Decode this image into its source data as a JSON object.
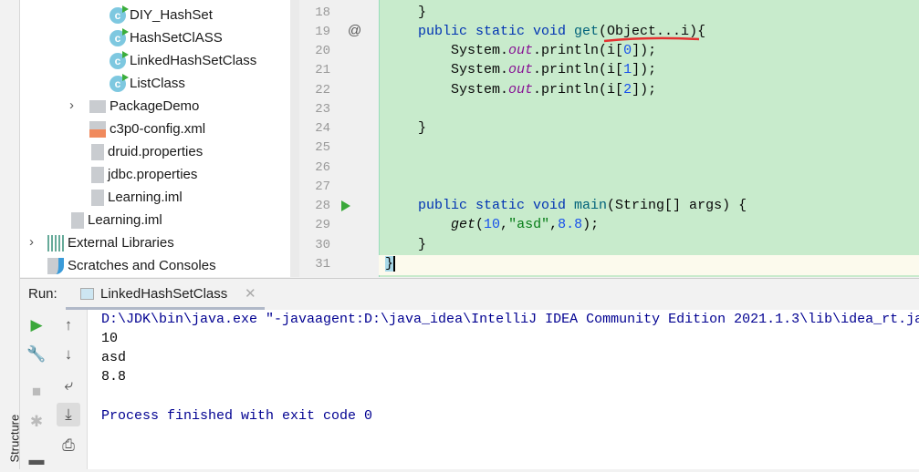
{
  "sidebar": {
    "structure_label": "Structure"
  },
  "project_tree": [
    {
      "label": "DIY_HashSet",
      "icon": "java-class-runnable-icon"
    },
    {
      "label": "HashSetClASS",
      "icon": "java-class-runnable-icon"
    },
    {
      "label": "LinkedHashSetClass",
      "icon": "java-class-runnable-icon"
    },
    {
      "label": "ListClass",
      "icon": "java-class-runnable-icon"
    },
    {
      "label": "PackageDemo",
      "icon": "package-folder-icon"
    },
    {
      "label": "c3p0-config.xml",
      "icon": "xml-file-icon"
    },
    {
      "label": "druid.properties",
      "icon": "properties-file-icon"
    },
    {
      "label": "jdbc.properties",
      "icon": "properties-file-icon"
    },
    {
      "label": "Learning.iml",
      "icon": "iml-file-icon"
    },
    {
      "label": "Learning.iml",
      "icon": "iml-file-icon"
    },
    {
      "label": "External Libraries",
      "icon": "libraries-icon"
    },
    {
      "label": "Scratches and Consoles",
      "icon": "scratches-icon"
    }
  ],
  "editor": {
    "line_numbers": [
      "18",
      "19",
      "20",
      "21",
      "22",
      "23",
      "24",
      "25",
      "26",
      "27",
      "28",
      "29",
      "30",
      "31"
    ],
    "lines": {
      "l18": "}",
      "l19_kw": "public static void ",
      "l19_fn": "get",
      "l19_rest": "(Object...i){",
      "l20a": "System.",
      "out": "out",
      "l20b": ".println(i[",
      "n0": "0",
      "n1": "1",
      "n2": "2",
      "close": "]);",
      "l24": "}",
      "l28_kw": "public static void ",
      "l28_fn": "main",
      "l28_rest": "(String[] args) {",
      "l29_fn": "get",
      "l29_p": "(",
      "l29_n1": "10",
      "l29_c": ",",
      "l29_s": "\"asd\"",
      "l29_n2": "8.8",
      "l29_end": ");",
      "l30": "}",
      "l31": "}"
    },
    "override_marker": "@"
  },
  "run_panel": {
    "label": "Run:",
    "tab": "LinkedHashSetClass",
    "console": [
      "D:\\JDK\\bin\\java.exe \"-javaagent:D:\\java_idea\\IntelliJ IDEA Community Edition 2021.1.3\\lib\\idea_rt.ja",
      "10",
      "asd",
      "8.8",
      "",
      "Process finished with exit code 0"
    ]
  },
  "colors": {
    "changed_bg": "#c8ebcc",
    "keyword": "#0033b3",
    "string": "#067d17",
    "number": "#1750eb",
    "console": "#000091"
  }
}
